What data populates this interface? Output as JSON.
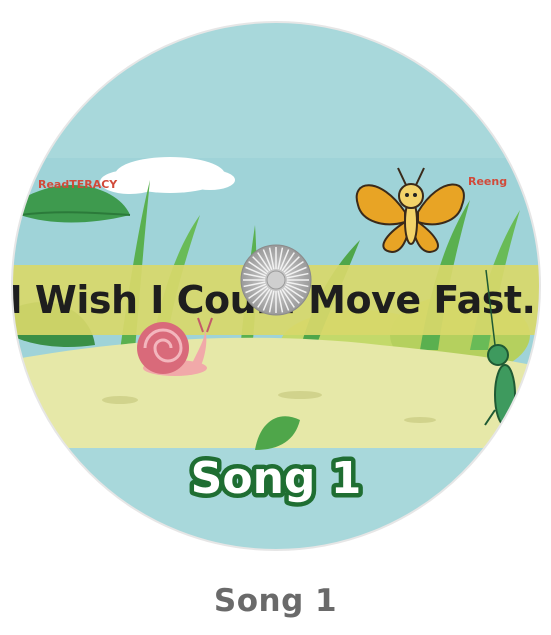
{
  "disc": {
    "title": "I Wish I Could Move Fast.",
    "label": "Song 1",
    "logo_left": "ReadTERACY",
    "logo_right": "Reeng"
  },
  "caption": "Song 1",
  "colors": {
    "sky": "#9fd3d8",
    "title_band": "#d8d86a",
    "ground": "#e6e8a8",
    "label_outline": "#1f6e32",
    "caption": "#6a6a6a"
  }
}
